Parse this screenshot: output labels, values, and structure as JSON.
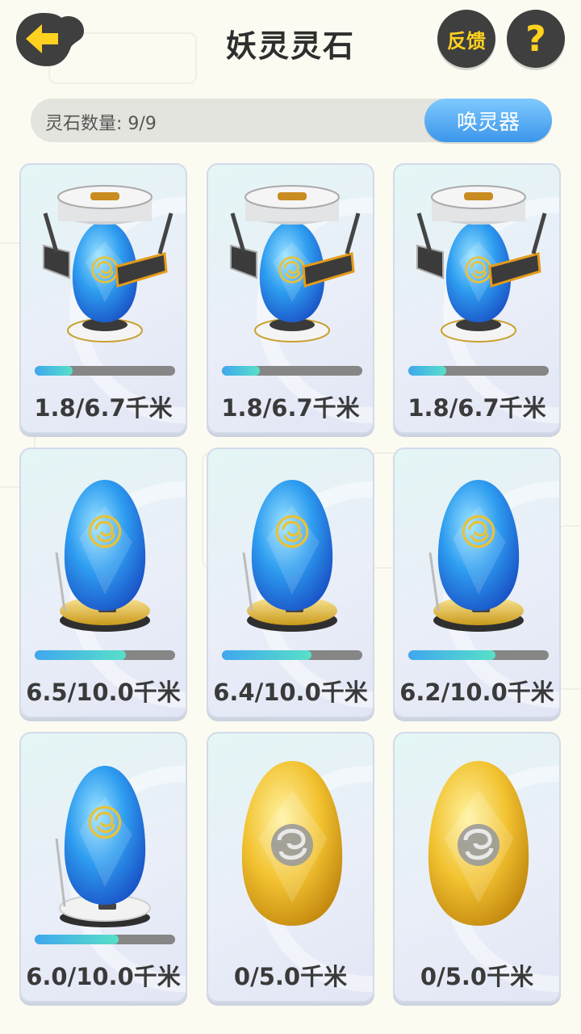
{
  "header": {
    "title": "妖灵灵石",
    "feedback_label": "反馈",
    "help_label": "?"
  },
  "count_bar": {
    "label": "灵石数量: 9/9",
    "summon_label": "唤灵器"
  },
  "cards": [
    {
      "distance": "1.8/6.7千米",
      "progress": 0.27,
      "type": "blue-egg-with-incubator-machine"
    },
    {
      "distance": "1.8/6.7千米",
      "progress": 0.27,
      "type": "blue-egg-with-incubator-machine"
    },
    {
      "distance": "1.8/6.7千米",
      "progress": 0.27,
      "type": "blue-egg-with-incubator-machine"
    },
    {
      "distance": "6.5/10.0千米",
      "progress": 0.65,
      "type": "blue-egg-on-gold-stand"
    },
    {
      "distance": "6.4/10.0千米",
      "progress": 0.64,
      "type": "blue-egg-on-gold-stand"
    },
    {
      "distance": "6.2/10.0千米",
      "progress": 0.62,
      "type": "blue-egg-on-gold-stand"
    },
    {
      "distance": "6.0/10.0千米",
      "progress": 0.6,
      "type": "blue-egg-on-white-stand"
    },
    {
      "distance": "0/5.0千米",
      "progress": 0,
      "type": "gold-egg"
    },
    {
      "distance": "0/5.0千米",
      "progress": 0,
      "type": "gold-egg"
    }
  ],
  "colors": {
    "accent_yellow": "#ffd21f",
    "button_dark": "#3f3f3f",
    "summon_blue": "#3b96ea",
    "progress_fill": "#3fa7ee"
  }
}
